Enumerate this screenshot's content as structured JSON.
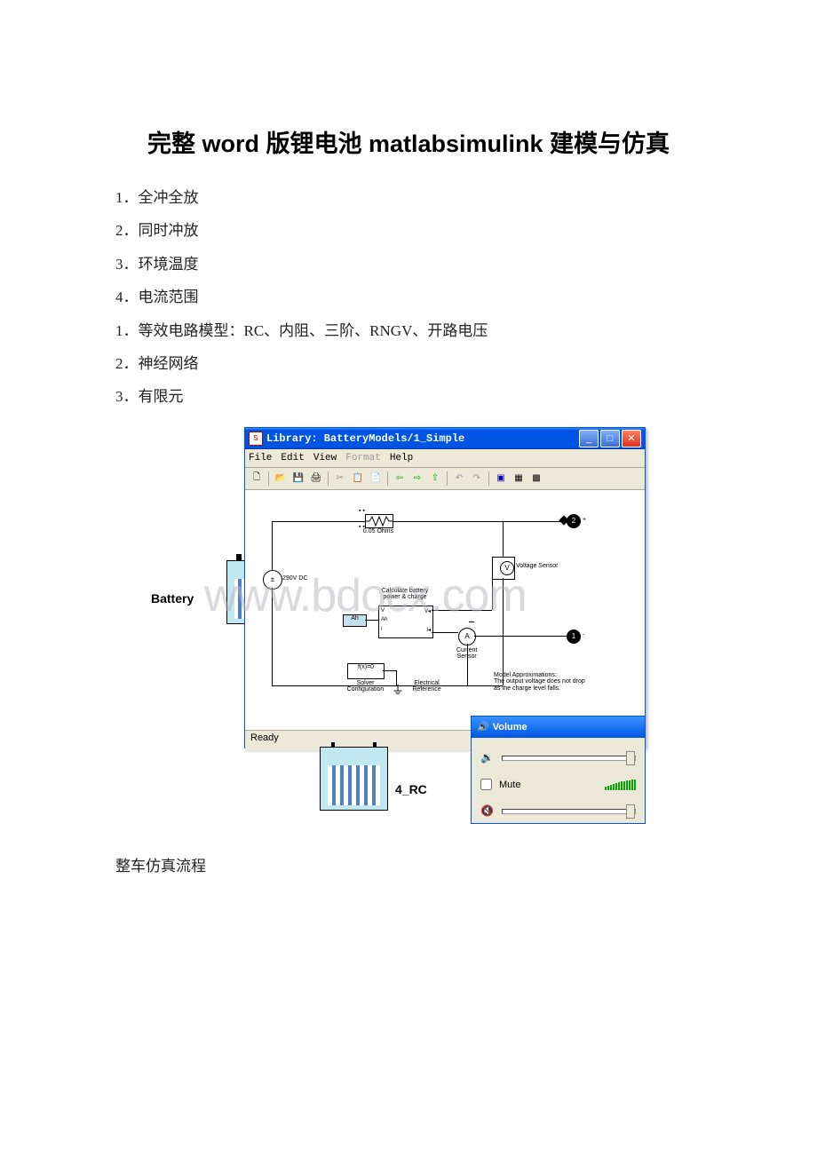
{
  "title": "完整 word 版锂电池 matlabsimulink 建模与仿真",
  "items_a": [
    "1．全冲全放",
    "2．同时冲放",
    "3．环境温度",
    "4．电流范围"
  ],
  "items_b": [
    "1．等效电路模型：RC、内阻、三阶、RNGV、开路电压",
    "2．神经网络",
    "3．有限元"
  ],
  "battery_label": "Battery",
  "rc_label": "4_RC",
  "footer": "整车仿真流程",
  "watermark": "www.bdocx.com",
  "simulink": {
    "window_title": "Library: BatteryModels/1_Simple",
    "menu": [
      "File",
      "Edit",
      "View",
      "Format",
      "Help"
    ],
    "labels": {
      "resistor": "0.05 Ohms",
      "dc_source": "290V DC",
      "voltage_sensor": "Voltage Sensor",
      "calc": "Calculate battery\npower & charge",
      "ah": "Ah",
      "current_sensor": "Current\nSensor",
      "solver_block": "f(x)=0",
      "solver": "Solver\nConfiguration",
      "elec_ref": "Electrical\nReference",
      "approx": "Model Approximations:\nThe output voltage does not drop\nas the charge level falls.",
      "port_plus": "+",
      "port_minus": "-",
      "v": "V",
      "a": "A",
      "i": "I",
      "port1": "1",
      "port2": "2"
    },
    "status": "Ready"
  },
  "volume": {
    "title": "Volume",
    "mute": "Mute"
  }
}
